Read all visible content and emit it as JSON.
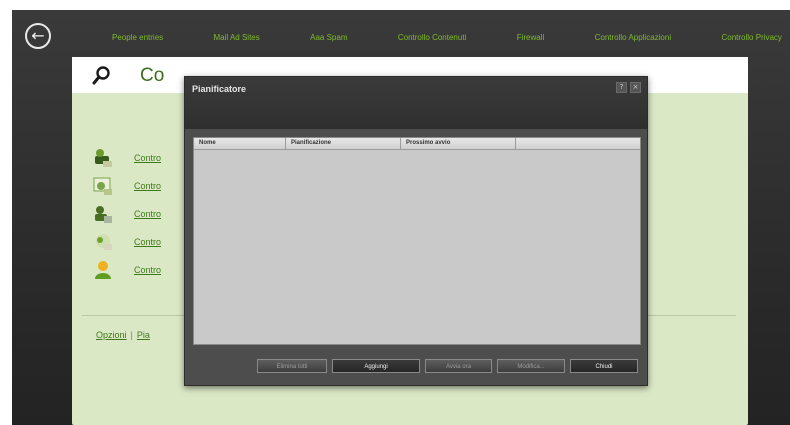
{
  "back_glyph": "←",
  "topnav": [
    "People entries",
    "Mail Ad Sites",
    "Aaa Spam",
    "Controllo Contenuti",
    "Firewall",
    "Controllo Applicazioni",
    "Controllo Privacy"
  ],
  "panel": {
    "title": "Co",
    "controls": [
      "Contro",
      "Contro",
      "Contro",
      "Contro",
      "Contro"
    ],
    "footer": {
      "left": "Opzioni",
      "sep": "|",
      "right": "Pia"
    }
  },
  "modal": {
    "title": "Pianificatore",
    "controls": [
      "?",
      "×"
    ],
    "columns": [
      "Nome",
      "Pianificazione",
      "Prossimo avvio",
      ""
    ],
    "buttons": [
      "Elimina tutti",
      "Aggiungi",
      "Avvia ora",
      "Modifica...",
      "Chiudi"
    ]
  },
  "colors": {
    "accent": "#7dba2b",
    "panel_bg": "#dbe8c6",
    "link": "#3f7a1a",
    "modal_bg": "#4d4d4d",
    "grid_bg": "#c9c9c9"
  }
}
